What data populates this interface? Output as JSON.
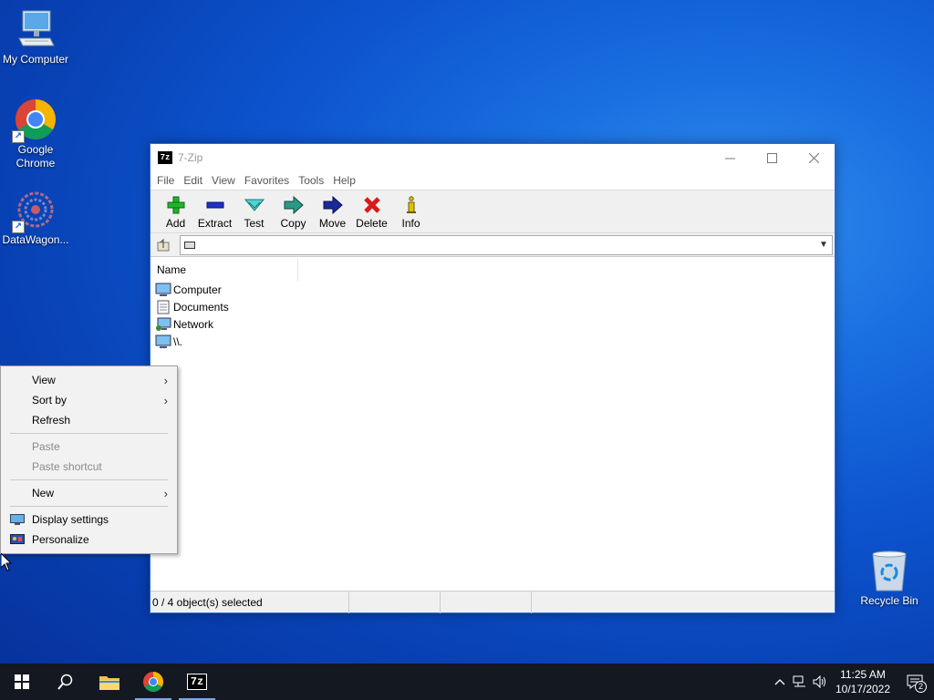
{
  "desktop": {
    "icons": [
      {
        "label": "My Computer"
      },
      {
        "label": "Google Chrome"
      },
      {
        "label": "DataWagon..."
      }
    ],
    "recycle_bin": "Recycle Bin"
  },
  "window": {
    "title": "7-Zip",
    "logo_text": "7z",
    "menu": [
      "File",
      "Edit",
      "View",
      "Favorites",
      "Tools",
      "Help"
    ],
    "toolbar": [
      {
        "label": "Add",
        "icon": "add-plus-icon"
      },
      {
        "label": "Extract",
        "icon": "extract-minus-icon"
      },
      {
        "label": "Test",
        "icon": "test-check-icon"
      },
      {
        "label": "Copy",
        "icon": "copy-arrow-icon"
      },
      {
        "label": "Move",
        "icon": "move-arrow-icon"
      },
      {
        "label": "Delete",
        "icon": "delete-x-icon"
      },
      {
        "label": "Info",
        "icon": "info-icon"
      }
    ],
    "address": {
      "value": ""
    },
    "list": {
      "columns": [
        "Name"
      ],
      "rows": [
        {
          "name": "Computer",
          "icon": "computer-icon"
        },
        {
          "name": "Documents",
          "icon": "document-icon"
        },
        {
          "name": "Network",
          "icon": "network-icon"
        },
        {
          "name": "\\\\.",
          "icon": "computer-icon"
        }
      ]
    },
    "status": {
      "selected": "0 / 4 object(s) selected"
    }
  },
  "context_menu": {
    "items": [
      {
        "label": "View",
        "submenu": true,
        "enabled": true
      },
      {
        "label": "Sort by",
        "submenu": true,
        "enabled": true
      },
      {
        "label": "Refresh",
        "submenu": false,
        "enabled": true
      },
      {
        "label": "Paste",
        "submenu": false,
        "enabled": false
      },
      {
        "label": "Paste shortcut",
        "submenu": false,
        "enabled": false
      },
      {
        "label": "New",
        "submenu": true,
        "enabled": true
      },
      {
        "label": "Display settings",
        "submenu": false,
        "enabled": true,
        "icon": "display-settings-icon"
      },
      {
        "label": "Personalize",
        "submenu": false,
        "enabled": true,
        "icon": "personalize-icon"
      }
    ]
  },
  "taskbar": {
    "tray_time": "11:25 AM",
    "tray_date": "10/17/2022",
    "notification_count": "2",
    "apps": [
      "start",
      "search",
      "file-explorer",
      "chrome",
      "7-zip"
    ],
    "app_logo_7z": "7z"
  }
}
